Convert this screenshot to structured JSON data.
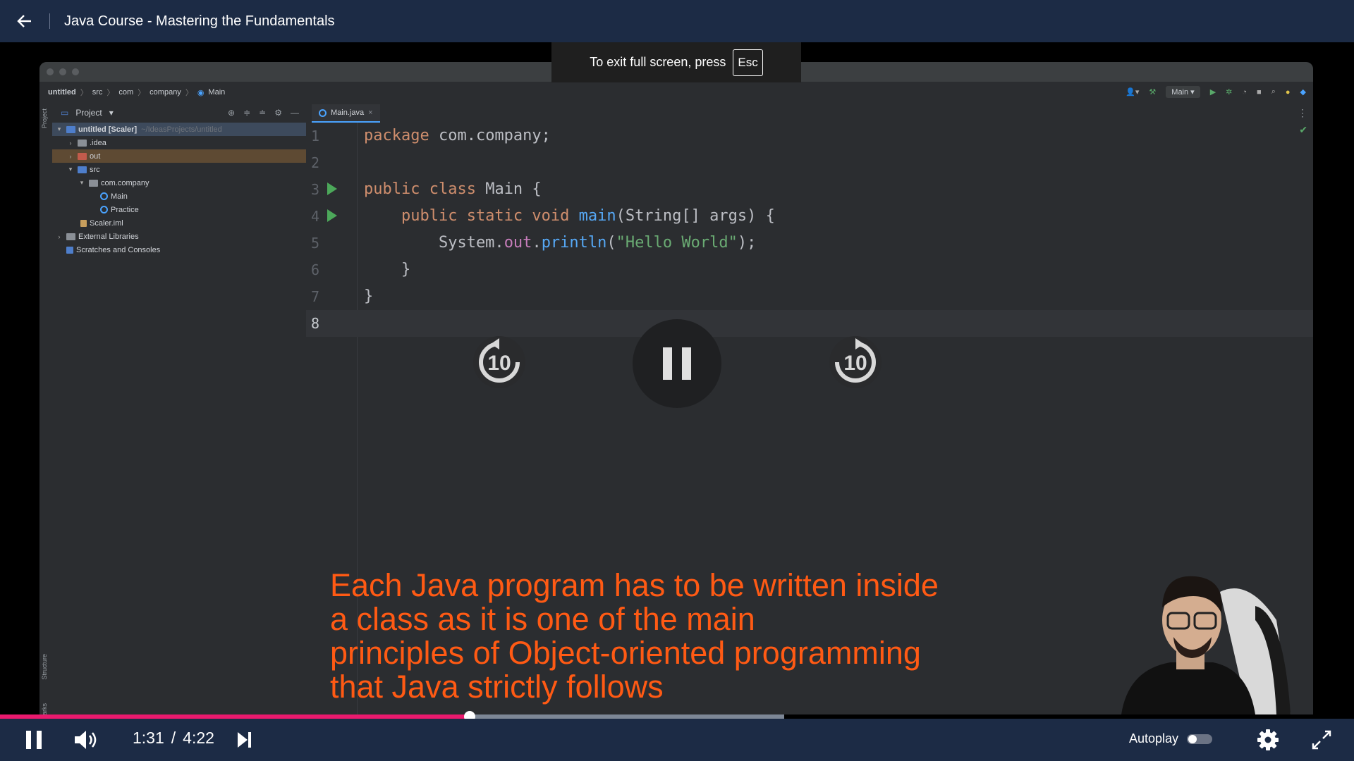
{
  "header": {
    "title": "Java Course - Mastering the Fundamentals"
  },
  "fullscreen_notice": {
    "text": "To exit full screen, press",
    "key": "Esc"
  },
  "ide": {
    "breadcrumb": [
      "untitled",
      "src",
      "com",
      "company",
      "Main"
    ],
    "run_config": "Main",
    "project_panel_title": "Project",
    "project_tree": [
      {
        "label": "untitled [Scaler]",
        "path": "~/IdeasProjects/untitled"
      },
      {
        "label": ".idea"
      },
      {
        "label": "out"
      },
      {
        "label": "src"
      },
      {
        "label": "com.company"
      },
      {
        "label": "Main"
      },
      {
        "label": "Practice"
      },
      {
        "label": "Scaler.iml"
      },
      {
        "label": "External Libraries"
      },
      {
        "label": "Scratches and Consoles"
      }
    ],
    "side_labels": {
      "project": "Project",
      "structure": "Structure",
      "bookmarks": "Bookmarks"
    },
    "editor_tab": "Main.java",
    "line_numbers": [
      "1",
      "2",
      "3",
      "4",
      "5",
      "6",
      "7",
      "8"
    ],
    "code": {
      "l1": {
        "kw": "package",
        "rest": " com.company;"
      },
      "l3": {
        "a": "public class",
        "b": " Main {"
      },
      "l4": {
        "a": "    public static void",
        "b": " ",
        "fn": "main",
        "c": "(String[] args) {"
      },
      "l5": {
        "a": "        System.",
        "fld": "out",
        "dot": ".",
        "fn": "println",
        "p1": "(",
        "str": "\"Hello World\"",
        "p2": ");"
      },
      "l6": "    }",
      "l7": "}"
    }
  },
  "overlay": {
    "seek_back_seconds": "10",
    "seek_forward_seconds": "10"
  },
  "caption_lines": [
    "Each Java program has to be written inside",
    "a class as it is one of the main",
    "principles of Object-oriented programming",
    "that Java strictly follows"
  ],
  "player": {
    "current_time": "1:31",
    "separator": "/",
    "duration": "4:22",
    "progress_fraction": 0.347,
    "buffered_fraction": 0.579,
    "autoplay_label": "Autoplay",
    "autoplay_on": false
  },
  "colors": {
    "accent": "#ea1a6e",
    "header_bg": "#1c2b45",
    "caption": "#ff5a14"
  }
}
